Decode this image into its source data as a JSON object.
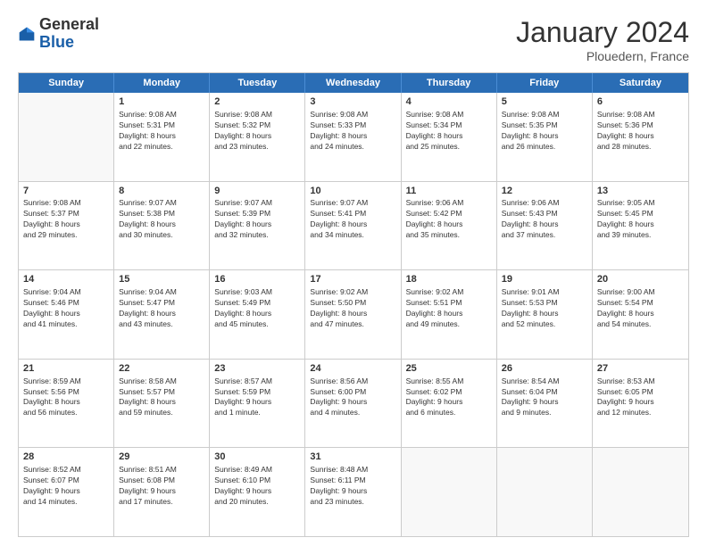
{
  "header": {
    "logo_general": "General",
    "logo_blue": "Blue",
    "month_title": "January 2024",
    "location": "Plouedern, France"
  },
  "weekdays": [
    "Sunday",
    "Monday",
    "Tuesday",
    "Wednesday",
    "Thursday",
    "Friday",
    "Saturday"
  ],
  "rows": [
    [
      {
        "day": "",
        "lines": []
      },
      {
        "day": "1",
        "lines": [
          "Sunrise: 9:08 AM",
          "Sunset: 5:31 PM",
          "Daylight: 8 hours",
          "and 22 minutes."
        ]
      },
      {
        "day": "2",
        "lines": [
          "Sunrise: 9:08 AM",
          "Sunset: 5:32 PM",
          "Daylight: 8 hours",
          "and 23 minutes."
        ]
      },
      {
        "day": "3",
        "lines": [
          "Sunrise: 9:08 AM",
          "Sunset: 5:33 PM",
          "Daylight: 8 hours",
          "and 24 minutes."
        ]
      },
      {
        "day": "4",
        "lines": [
          "Sunrise: 9:08 AM",
          "Sunset: 5:34 PM",
          "Daylight: 8 hours",
          "and 25 minutes."
        ]
      },
      {
        "day": "5",
        "lines": [
          "Sunrise: 9:08 AM",
          "Sunset: 5:35 PM",
          "Daylight: 8 hours",
          "and 26 minutes."
        ]
      },
      {
        "day": "6",
        "lines": [
          "Sunrise: 9:08 AM",
          "Sunset: 5:36 PM",
          "Daylight: 8 hours",
          "and 28 minutes."
        ]
      }
    ],
    [
      {
        "day": "7",
        "lines": [
          "Sunrise: 9:08 AM",
          "Sunset: 5:37 PM",
          "Daylight: 8 hours",
          "and 29 minutes."
        ]
      },
      {
        "day": "8",
        "lines": [
          "Sunrise: 9:07 AM",
          "Sunset: 5:38 PM",
          "Daylight: 8 hours",
          "and 30 minutes."
        ]
      },
      {
        "day": "9",
        "lines": [
          "Sunrise: 9:07 AM",
          "Sunset: 5:39 PM",
          "Daylight: 8 hours",
          "and 32 minutes."
        ]
      },
      {
        "day": "10",
        "lines": [
          "Sunrise: 9:07 AM",
          "Sunset: 5:41 PM",
          "Daylight: 8 hours",
          "and 34 minutes."
        ]
      },
      {
        "day": "11",
        "lines": [
          "Sunrise: 9:06 AM",
          "Sunset: 5:42 PM",
          "Daylight: 8 hours",
          "and 35 minutes."
        ]
      },
      {
        "day": "12",
        "lines": [
          "Sunrise: 9:06 AM",
          "Sunset: 5:43 PM",
          "Daylight: 8 hours",
          "and 37 minutes."
        ]
      },
      {
        "day": "13",
        "lines": [
          "Sunrise: 9:05 AM",
          "Sunset: 5:45 PM",
          "Daylight: 8 hours",
          "and 39 minutes."
        ]
      }
    ],
    [
      {
        "day": "14",
        "lines": [
          "Sunrise: 9:04 AM",
          "Sunset: 5:46 PM",
          "Daylight: 8 hours",
          "and 41 minutes."
        ]
      },
      {
        "day": "15",
        "lines": [
          "Sunrise: 9:04 AM",
          "Sunset: 5:47 PM",
          "Daylight: 8 hours",
          "and 43 minutes."
        ]
      },
      {
        "day": "16",
        "lines": [
          "Sunrise: 9:03 AM",
          "Sunset: 5:49 PM",
          "Daylight: 8 hours",
          "and 45 minutes."
        ]
      },
      {
        "day": "17",
        "lines": [
          "Sunrise: 9:02 AM",
          "Sunset: 5:50 PM",
          "Daylight: 8 hours",
          "and 47 minutes."
        ]
      },
      {
        "day": "18",
        "lines": [
          "Sunrise: 9:02 AM",
          "Sunset: 5:51 PM",
          "Daylight: 8 hours",
          "and 49 minutes."
        ]
      },
      {
        "day": "19",
        "lines": [
          "Sunrise: 9:01 AM",
          "Sunset: 5:53 PM",
          "Daylight: 8 hours",
          "and 52 minutes."
        ]
      },
      {
        "day": "20",
        "lines": [
          "Sunrise: 9:00 AM",
          "Sunset: 5:54 PM",
          "Daylight: 8 hours",
          "and 54 minutes."
        ]
      }
    ],
    [
      {
        "day": "21",
        "lines": [
          "Sunrise: 8:59 AM",
          "Sunset: 5:56 PM",
          "Daylight: 8 hours",
          "and 56 minutes."
        ]
      },
      {
        "day": "22",
        "lines": [
          "Sunrise: 8:58 AM",
          "Sunset: 5:57 PM",
          "Daylight: 8 hours",
          "and 59 minutes."
        ]
      },
      {
        "day": "23",
        "lines": [
          "Sunrise: 8:57 AM",
          "Sunset: 5:59 PM",
          "Daylight: 9 hours",
          "and 1 minute."
        ]
      },
      {
        "day": "24",
        "lines": [
          "Sunrise: 8:56 AM",
          "Sunset: 6:00 PM",
          "Daylight: 9 hours",
          "and 4 minutes."
        ]
      },
      {
        "day": "25",
        "lines": [
          "Sunrise: 8:55 AM",
          "Sunset: 6:02 PM",
          "Daylight: 9 hours",
          "and 6 minutes."
        ]
      },
      {
        "day": "26",
        "lines": [
          "Sunrise: 8:54 AM",
          "Sunset: 6:04 PM",
          "Daylight: 9 hours",
          "and 9 minutes."
        ]
      },
      {
        "day": "27",
        "lines": [
          "Sunrise: 8:53 AM",
          "Sunset: 6:05 PM",
          "Daylight: 9 hours",
          "and 12 minutes."
        ]
      }
    ],
    [
      {
        "day": "28",
        "lines": [
          "Sunrise: 8:52 AM",
          "Sunset: 6:07 PM",
          "Daylight: 9 hours",
          "and 14 minutes."
        ]
      },
      {
        "day": "29",
        "lines": [
          "Sunrise: 8:51 AM",
          "Sunset: 6:08 PM",
          "Daylight: 9 hours",
          "and 17 minutes."
        ]
      },
      {
        "day": "30",
        "lines": [
          "Sunrise: 8:49 AM",
          "Sunset: 6:10 PM",
          "Daylight: 9 hours",
          "and 20 minutes."
        ]
      },
      {
        "day": "31",
        "lines": [
          "Sunrise: 8:48 AM",
          "Sunset: 6:11 PM",
          "Daylight: 9 hours",
          "and 23 minutes."
        ]
      },
      {
        "day": "",
        "lines": []
      },
      {
        "day": "",
        "lines": []
      },
      {
        "day": "",
        "lines": []
      }
    ]
  ]
}
